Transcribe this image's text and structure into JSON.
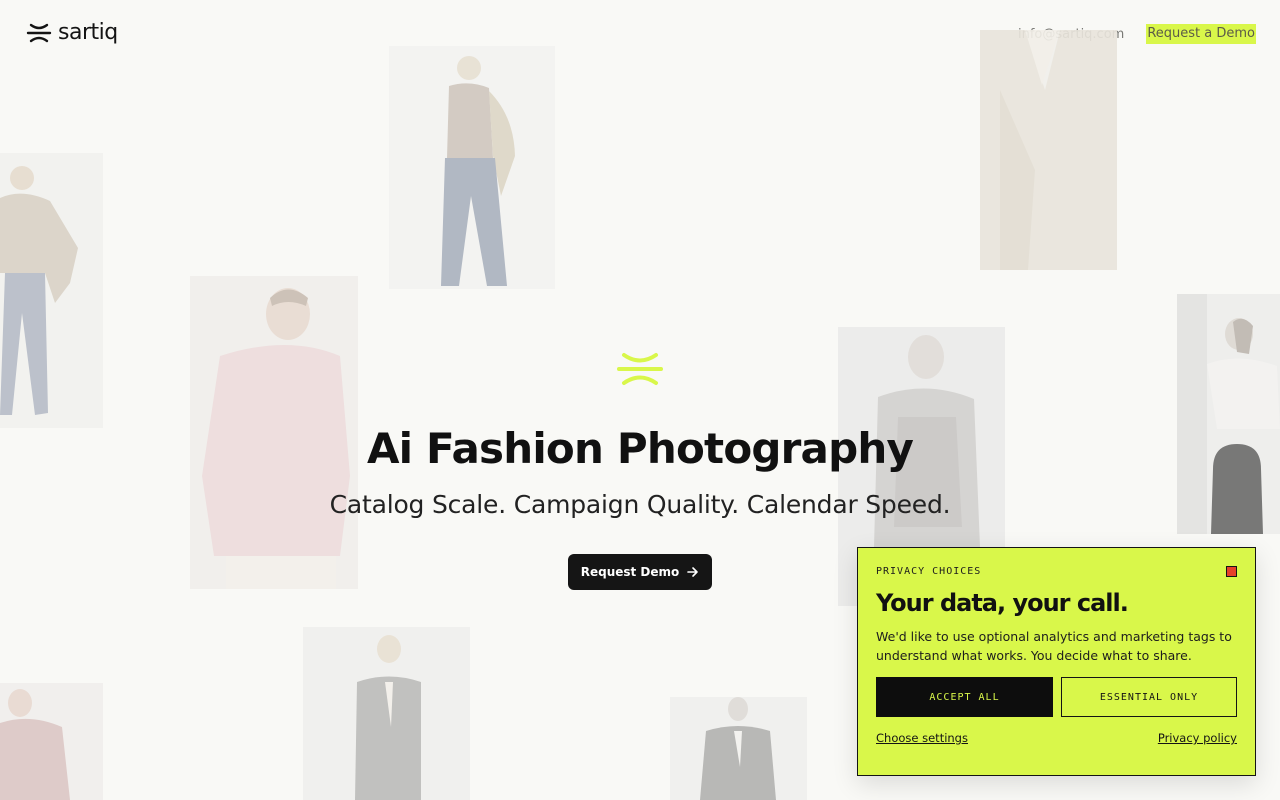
{
  "header": {
    "brand": "sartiq",
    "email": "info@sartiq.com",
    "demo_link": "Request a Demo"
  },
  "hero": {
    "title": "Ai Fashion Photography",
    "subtitle": "Catalog Scale. Campaign Quality. Calendar Speed.",
    "cta_label": "Request Demo"
  },
  "privacy": {
    "eyebrow": "PRIVACY CHOICES",
    "title": "Your data, your call.",
    "body": "We'd like to use optional analytics and marketing tags to understand what works. You decide what to share.",
    "accept_label": "ACCEPT ALL",
    "essential_label": "ESSENTIAL ONLY",
    "settings_link": "Choose settings",
    "policy_link": "Privacy policy"
  },
  "colors": {
    "accent": "#d9f74a",
    "background": "#f9f9f6",
    "dark": "#141414",
    "close": "#e6402a"
  },
  "icons": [
    "sartiq-logo-icon",
    "sartiq-mark-icon",
    "arrow-right-icon",
    "close-icon"
  ]
}
